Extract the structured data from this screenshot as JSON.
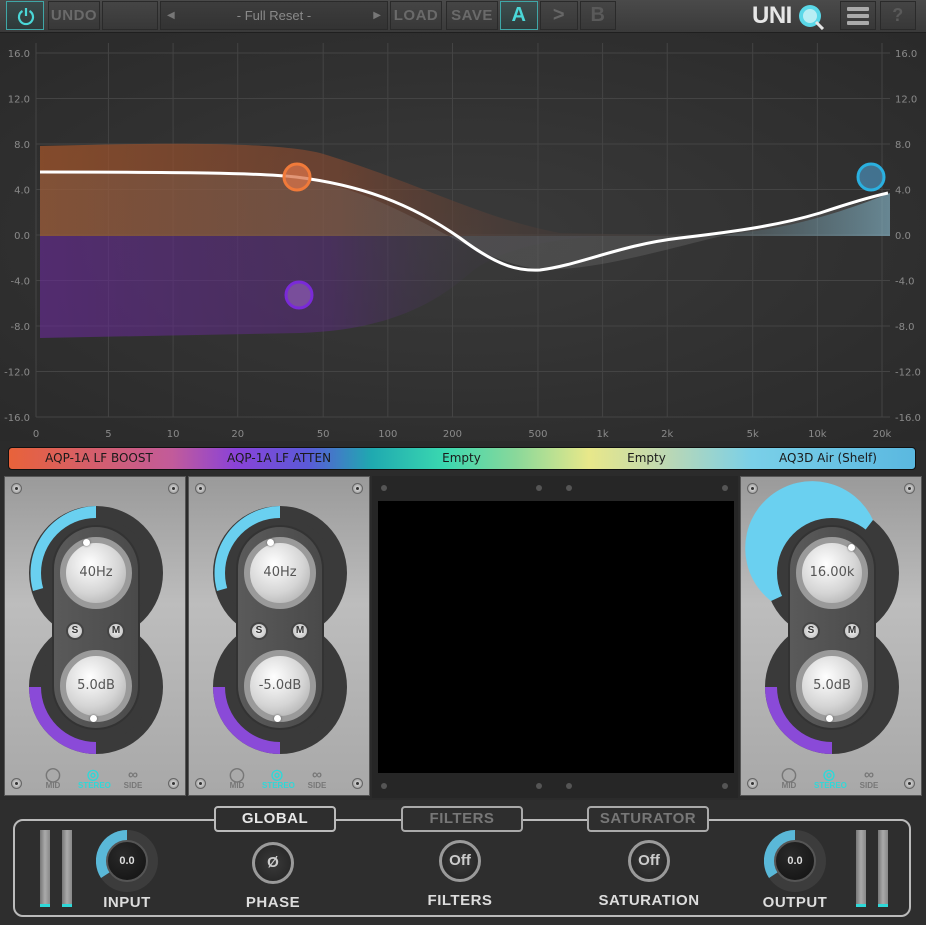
{
  "toolbar": {
    "undo_label": "UNDO",
    "preset_name": "- Full Reset -",
    "load_label": "LOAD",
    "save_label": "SAVE",
    "a_label": "A",
    "copy_label": ">",
    "b_label": "B",
    "logo_text": "UNI",
    "help_label": "?"
  },
  "graph": {
    "y_labels": [
      "16.0",
      "12.0",
      "8.0",
      "4.0",
      "0.0",
      "-4.0",
      "-8.0",
      "-12.0",
      "-16.0"
    ],
    "x_labels": [
      "0",
      "5",
      "10",
      "20",
      "50",
      "100",
      "200",
      "500",
      "1k",
      "2k",
      "5k",
      "10k",
      "20k"
    ],
    "nodes": [
      {
        "name": "band-1-node",
        "color": "#f07a3a",
        "gain": 5.0
      },
      {
        "name": "band-2-node",
        "color": "#7a2ad8",
        "gain": -5.0
      },
      {
        "name": "band-5-node",
        "color": "#2ab0e0",
        "gain": 5.0
      }
    ]
  },
  "bands": [
    {
      "label": "AQP-1A LF BOOST"
    },
    {
      "label": "AQP-1A LF ATTEN"
    },
    {
      "label": "Empty"
    },
    {
      "label": "Empty"
    },
    {
      "label": "AQ3D Air (Shelf)"
    }
  ],
  "panels": [
    {
      "freq": "40Hz",
      "gain": "5.0dB",
      "freq_fill": 0.22,
      "gain_fill": 0.55
    },
    {
      "freq": "40Hz",
      "gain": "-5.0dB",
      "freq_fill": 0.22,
      "gain_fill": 0.45
    },
    {
      "freq": "16.00k",
      "gain": "5.0dB",
      "freq_fill": 0.9,
      "gain_fill": 0.55
    }
  ],
  "panel_labels": {
    "solo": "S",
    "mute": "M",
    "mid": "MID",
    "stereo": "STEREO",
    "side": "SIDE"
  },
  "bottom": {
    "global_tab": "GLOBAL",
    "filters_tab": "FILTERS",
    "saturator_tab": "SATURATOR",
    "input_value": "0.0",
    "input_label": "INPUT",
    "phase_symbol": "Ø",
    "phase_label": "PHASE",
    "filters_value": "Off",
    "filters_label": "FILTERS",
    "saturation_value": "Off",
    "saturation_label": "SATURATION",
    "output_value": "0.0",
    "output_label": "OUTPUT"
  },
  "colors": {
    "accent": "#2fd8d8",
    "band1": "#f07a3a",
    "band2": "#7a2ad8",
    "band5": "#2ab0e0"
  }
}
